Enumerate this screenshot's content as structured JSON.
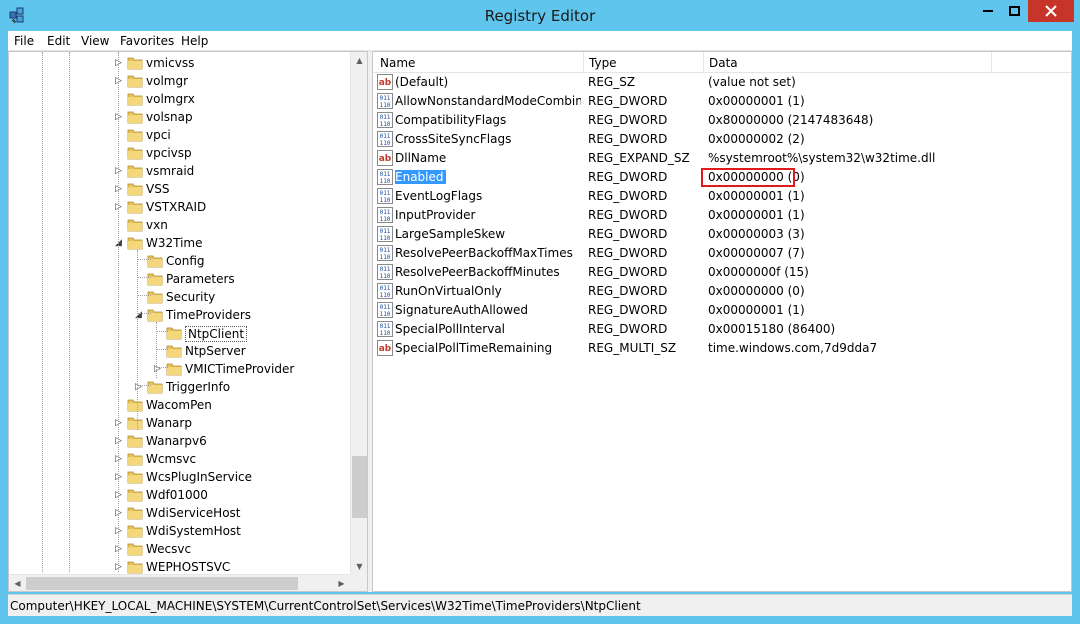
{
  "window": {
    "title": "Registry Editor"
  },
  "menu": [
    "File",
    "Edit",
    "View",
    "Favorites",
    "Help"
  ],
  "tree": [
    {
      "label": "vmicvss",
      "level": 0,
      "expander": "closed"
    },
    {
      "label": "volmgr",
      "level": 0,
      "expander": "closed"
    },
    {
      "label": "volmgrx",
      "level": 0,
      "expander": "none"
    },
    {
      "label": "volsnap",
      "level": 0,
      "expander": "closed"
    },
    {
      "label": "vpci",
      "level": 0,
      "expander": "none"
    },
    {
      "label": "vpcivsp",
      "level": 0,
      "expander": "none"
    },
    {
      "label": "vsmraid",
      "level": 0,
      "expander": "closed"
    },
    {
      "label": "VSS",
      "level": 0,
      "expander": "closed"
    },
    {
      "label": "VSTXRAID",
      "level": 0,
      "expander": "closed"
    },
    {
      "label": "vxn",
      "level": 0,
      "expander": "none"
    },
    {
      "label": "W32Time",
      "level": 0,
      "expander": "open"
    },
    {
      "label": "Config",
      "level": 1,
      "expander": "none"
    },
    {
      "label": "Parameters",
      "level": 1,
      "expander": "none"
    },
    {
      "label": "Security",
      "level": 1,
      "expander": "none"
    },
    {
      "label": "TimeProviders",
      "level": 1,
      "expander": "open"
    },
    {
      "label": "NtpClient",
      "level": 2,
      "expander": "none",
      "selected": true
    },
    {
      "label": "NtpServer",
      "level": 2,
      "expander": "none"
    },
    {
      "label": "VMICTimeProvider",
      "level": 2,
      "expander": "closed"
    },
    {
      "label": "TriggerInfo",
      "level": 1,
      "expander": "closed"
    },
    {
      "label": "WacomPen",
      "level": 0,
      "expander": "none"
    },
    {
      "label": "Wanarp",
      "level": 0,
      "expander": "closed"
    },
    {
      "label": "Wanarpv6",
      "level": 0,
      "expander": "closed"
    },
    {
      "label": "Wcmsvc",
      "level": 0,
      "expander": "closed"
    },
    {
      "label": "WcsPlugInService",
      "level": 0,
      "expander": "closed"
    },
    {
      "label": "Wdf01000",
      "level": 0,
      "expander": "closed"
    },
    {
      "label": "WdiServiceHost",
      "level": 0,
      "expander": "closed"
    },
    {
      "label": "WdiSystemHost",
      "level": 0,
      "expander": "closed"
    },
    {
      "label": "Wecsvc",
      "level": 0,
      "expander": "closed"
    },
    {
      "label": "WEPHOSTSVC",
      "level": 0,
      "expander": "closed"
    }
  ],
  "columns": {
    "name": "Name",
    "type": "Type",
    "data": "Data"
  },
  "values": [
    {
      "name": "(Default)",
      "type": "REG_SZ",
      "data": "(value not set)",
      "icon": "string"
    },
    {
      "name": "AllowNonstandardModeCombin...",
      "type": "REG_DWORD",
      "data": "0x00000001 (1)",
      "icon": "binary"
    },
    {
      "name": "CompatibilityFlags",
      "type": "REG_DWORD",
      "data": "0x80000000 (2147483648)",
      "icon": "binary"
    },
    {
      "name": "CrossSiteSyncFlags",
      "type": "REG_DWORD",
      "data": "0x00000002 (2)",
      "icon": "binary"
    },
    {
      "name": "DllName",
      "type": "REG_EXPAND_SZ",
      "data": "%systemroot%\\system32\\w32time.dll",
      "icon": "string"
    },
    {
      "name": "Enabled",
      "type": "REG_DWORD",
      "data": "0x00000000 (0)",
      "icon": "binary",
      "selected": true
    },
    {
      "name": "EventLogFlags",
      "type": "REG_DWORD",
      "data": "0x00000001 (1)",
      "icon": "binary"
    },
    {
      "name": "InputProvider",
      "type": "REG_DWORD",
      "data": "0x00000001 (1)",
      "icon": "binary"
    },
    {
      "name": "LargeSampleSkew",
      "type": "REG_DWORD",
      "data": "0x00000003 (3)",
      "icon": "binary"
    },
    {
      "name": "ResolvePeerBackoffMaxTimes",
      "type": "REG_DWORD",
      "data": "0x00000007 (7)",
      "icon": "binary"
    },
    {
      "name": "ResolvePeerBackoffMinutes",
      "type": "REG_DWORD",
      "data": "0x0000000f (15)",
      "icon": "binary"
    },
    {
      "name": "RunOnVirtualOnly",
      "type": "REG_DWORD",
      "data": "0x00000000 (0)",
      "icon": "binary"
    },
    {
      "name": "SignatureAuthAllowed",
      "type": "REG_DWORD",
      "data": "0x00000001 (1)",
      "icon": "binary"
    },
    {
      "name": "SpecialPollInterval",
      "type": "REG_DWORD",
      "data": "0x00015180 (86400)",
      "icon": "binary"
    },
    {
      "name": "SpecialPollTimeRemaining",
      "type": "REG_MULTI_SZ",
      "data": "time.windows.com,7d9dda7",
      "icon": "string"
    }
  ],
  "status": {
    "path": "Computer\\HKEY_LOCAL_MACHINE\\SYSTEM\\CurrentControlSet\\Services\\W32Time\\TimeProviders\\NtpClient"
  },
  "colors": {
    "titlebar": "#5fc5ec",
    "close": "#c7342a",
    "selection": "#3399ff",
    "highlight_box": "#e01b1b",
    "folder": "#e8c25a"
  }
}
